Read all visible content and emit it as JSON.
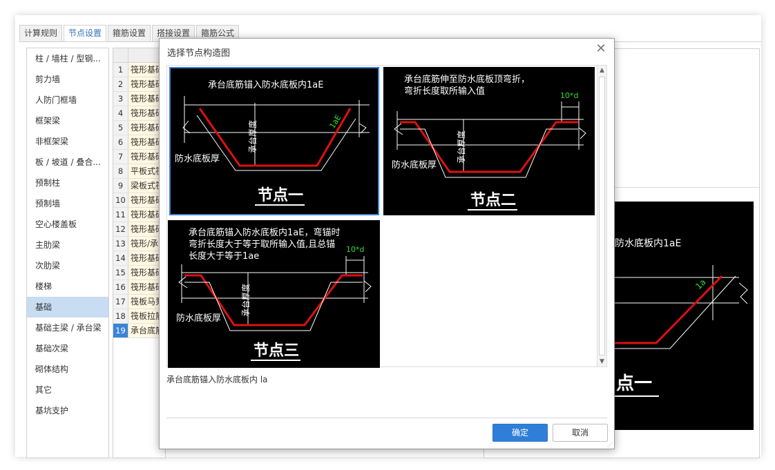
{
  "tabs": [
    "计算规则",
    "节点设置",
    "箍筋设置",
    "搭接设置",
    "箍筋公式"
  ],
  "sidebar": [
    "柱 / 墙柱 / 型钢...",
    "剪力墙",
    "人防门框墙",
    "框架梁",
    "非框架梁",
    "板 / 坡道 / 叠合...",
    "预制柱",
    "预制墙",
    "空心楼盖板",
    "主肋梁",
    "次肋梁",
    "楼梯",
    "基础",
    "基础主梁 / 承台梁",
    "基础次梁",
    "砌体结构",
    "其它",
    "基坑支护"
  ],
  "grid_rows": [
    {
      "num": "1",
      "name": "筏形基础"
    },
    {
      "num": "2",
      "name": "筏形基础"
    },
    {
      "num": "3",
      "name": "筏形基础"
    },
    {
      "num": "4",
      "name": "筏形基础"
    },
    {
      "num": "5",
      "name": "筏形基础"
    },
    {
      "num": "6",
      "name": "筏形基础"
    },
    {
      "num": "7",
      "name": "筏形基础"
    },
    {
      "num": "8",
      "name": "平板式筏"
    },
    {
      "num": "9",
      "name": "梁板式筏"
    },
    {
      "num": "10",
      "name": "筏形基础"
    },
    {
      "num": "11",
      "name": "筏形基础"
    },
    {
      "num": "12",
      "name": "筏形基础"
    },
    {
      "num": "13",
      "name": "筏形/承台"
    },
    {
      "num": "14",
      "name": "筏形基础"
    },
    {
      "num": "15",
      "name": "筏形基础"
    },
    {
      "num": "16",
      "name": "筏形基础"
    },
    {
      "num": "17",
      "name": "筏板马凳"
    },
    {
      "num": "18",
      "name": "筏板拉筋"
    },
    {
      "num": "19",
      "name": "承台底筋"
    }
  ],
  "background_image": {
    "caption_partial": "防水底板内1aE",
    "label": "1a",
    "node": "点一"
  },
  "dialog": {
    "title": "选择节点构造图",
    "description": "承台底筋锚入防水底板内 la",
    "ok_label": "确定",
    "cancel_label": "取消",
    "nodes": [
      {
        "caption_lines": [
          "承台底筋锚入防水底板内1aE"
        ],
        "left_label": "防水底板厚",
        "vertical_label": "承台厚度",
        "dim_label": "1aE",
        "node_label": "节点一"
      },
      {
        "caption_lines": [
          "承台底筋伸至防水底板顶弯折，",
          "弯折长度取所输入值"
        ],
        "left_label": "防水底板厚",
        "vertical_label": "承台厚度",
        "dim_label": "10*d",
        "node_label": "节点二"
      },
      {
        "caption_lines": [
          "承台底筋锚入防水底板内1aE，弯锚时",
          "弯折长度大于等于取所输入值,且总锚",
          "长度大于等于1ae"
        ],
        "left_label": "防水底板厚",
        "vertical_label": "承台厚度",
        "dim_label": "10*d",
        "node_label": "节点三"
      }
    ]
  },
  "colors": {
    "accent": "#2f7fd8",
    "rebar": "#e01010",
    "dim_text": "#33dd33",
    "drawing_bg": "#000000",
    "selected_row": "#c8dcf2"
  }
}
